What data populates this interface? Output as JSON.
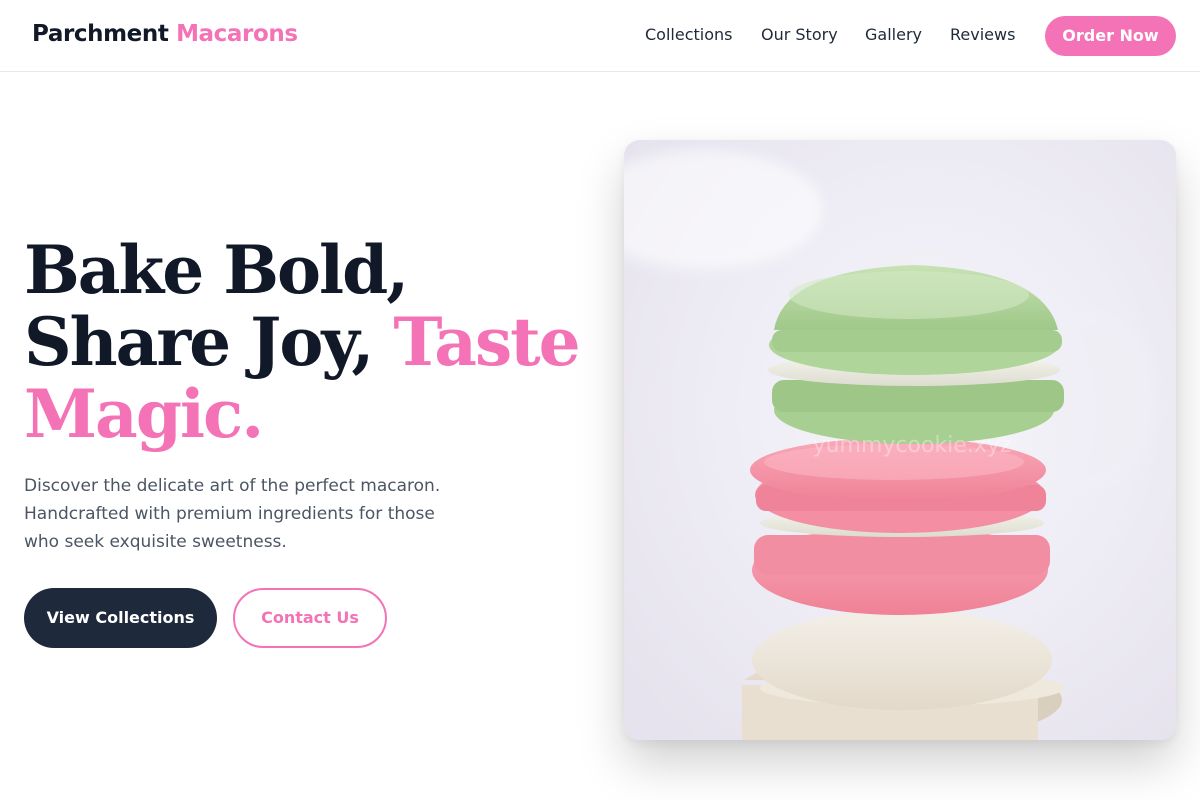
{
  "brand": {
    "first": "Parchment",
    "second": "Macarons",
    "accent_color": "#f472b6"
  },
  "nav": {
    "links": [
      "Collections",
      "Our Story",
      "Gallery",
      "Reviews"
    ],
    "cta": "Order Now"
  },
  "hero": {
    "title_line1": "Bake Bold,",
    "title_line2": "Share Joy,",
    "title_accent_line2": "Taste",
    "title_accent_line3": "Magic.",
    "description": "Discover the delicate art of the perfect macaron. Handcrafted with premium ingredients for those who seek exquisite sweetness.",
    "primary_button": "View Collections",
    "secondary_button": "Contact Us",
    "image_watermark": "yummycookie.xyz"
  },
  "colors": {
    "primary_dark": "#1e293b",
    "pink": "#f472b6",
    "text_dark": "#111827",
    "text_muted": "#4b5563"
  }
}
